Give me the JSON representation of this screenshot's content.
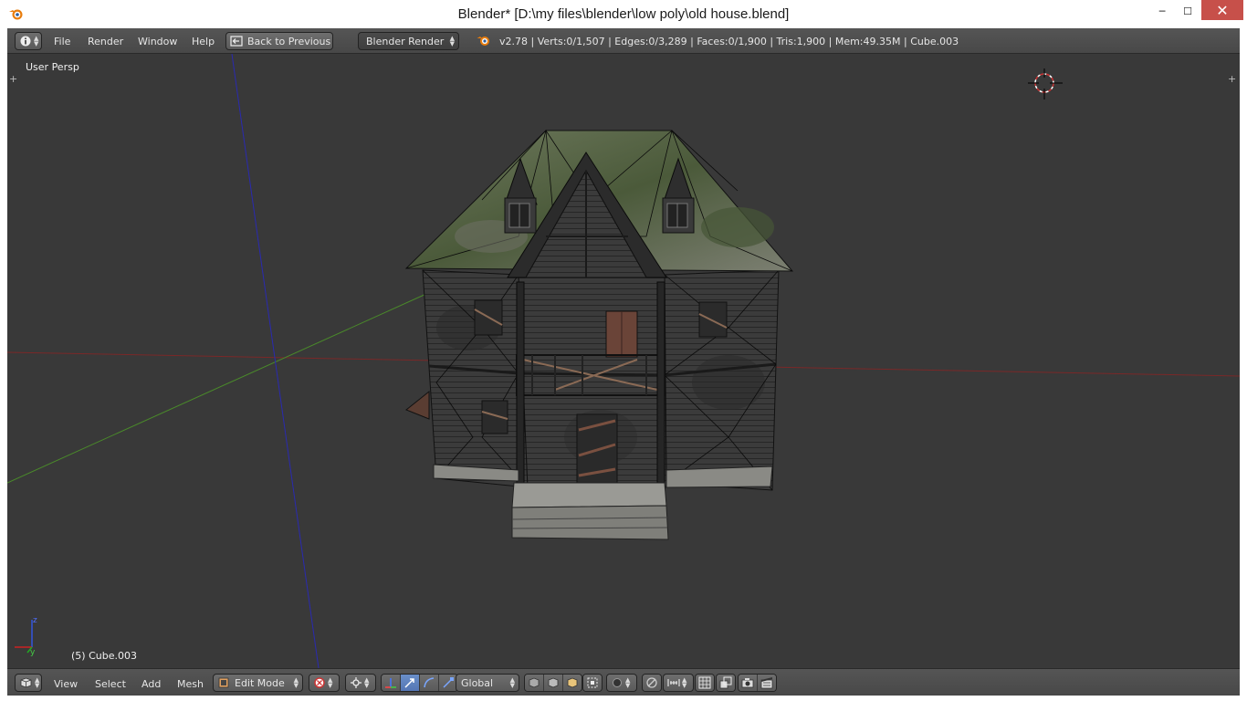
{
  "window": {
    "title": "Blender* [D:\\my files\\blender\\low poly\\old house.blend]",
    "minimize_glyph": "─",
    "maximize_glyph": "☐",
    "close_glyph": "✕"
  },
  "info_header": {
    "editor_type_icon": "info-icon",
    "menus": [
      "File",
      "Render",
      "Window",
      "Help"
    ],
    "back_button_label": "Back to Previous",
    "render_engine": "Blender Render",
    "stats": "v2.78 | Verts:0/1,507 | Edges:0/3,289 | Faces:0/1,900 | Tris:1,900 | Mem:49.35M | Cube.003"
  },
  "viewport": {
    "view_name": "User Persp",
    "object_info": "(5) Cube.003",
    "axis_labels": {
      "z": "z",
      "y": "y"
    },
    "colors": {
      "background": "#393939",
      "x_axis": "#8a2a2a",
      "y_axis": "#4a8a2a",
      "z_axis": "#2a2a9a"
    }
  },
  "view3d_header": {
    "editor_type_icon": "3d-view-icon",
    "menus": [
      "View",
      "Select",
      "Add",
      "Mesh"
    ],
    "mode": "Edit Mode",
    "transform_orientation": "Global"
  }
}
